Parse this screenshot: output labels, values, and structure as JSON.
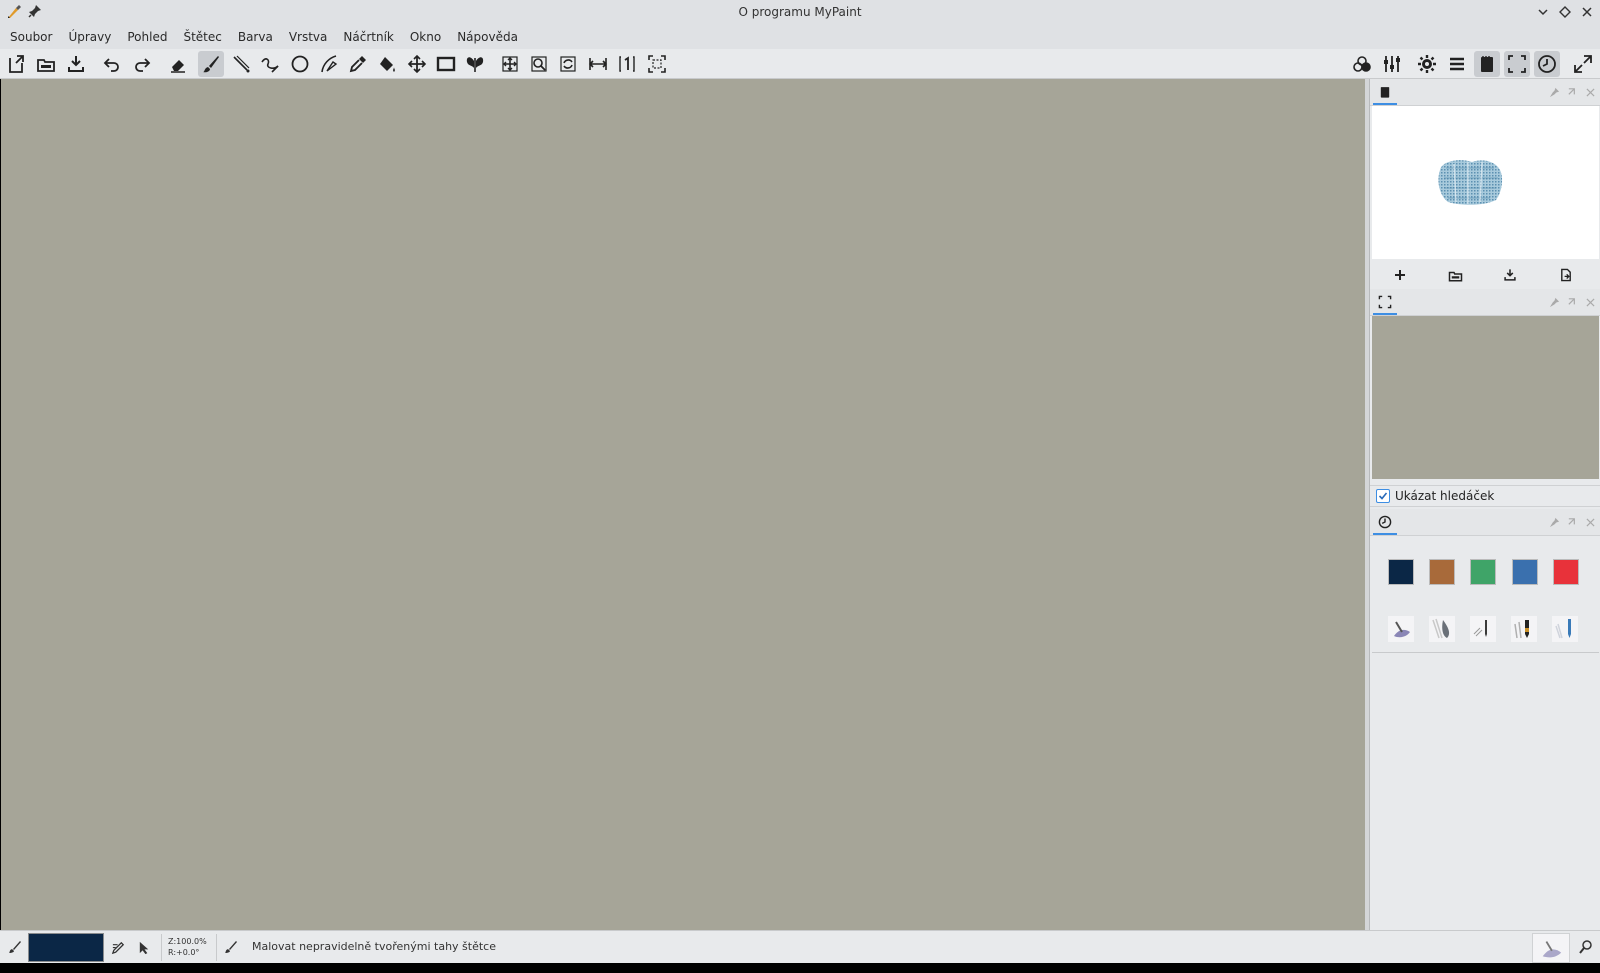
{
  "window": {
    "title": "O programu MyPaint"
  },
  "menu": [
    {
      "label": "Soubor"
    },
    {
      "label": "Úpravy"
    },
    {
      "label": "Pohled"
    },
    {
      "label": "Štětec"
    },
    {
      "label": "Barva"
    },
    {
      "label": "Vrstva"
    },
    {
      "label": "Náčrtník"
    },
    {
      "label": "Okno"
    },
    {
      "label": "Nápověda"
    }
  ],
  "toolbar_left": [
    "new-icon",
    "open-icon",
    "save-icon",
    "undo-icon",
    "redo-icon",
    "eraser-icon",
    "brush-icon",
    "inking-icon",
    "freehand-icon",
    "ellipse-icon",
    "pen-path-icon",
    "color-picker-icon",
    "fill-icon",
    "move-icon",
    "frame-icon",
    "symmetry-icon",
    "pan-icon",
    "zoom-icon",
    "rotate-icon",
    "mirror-icon",
    "reset-view-icon",
    "fit-view-icon"
  ],
  "toolbar_right": [
    "color-wheel-icon",
    "brush-settings-icon",
    "preferences-icon",
    "layers-icon",
    "scratchpad-icon",
    "preview-icon",
    "history-icon",
    "fullscreen-icon"
  ],
  "sidebar": {
    "preview": {
      "show_viewfinder_label": "Ukázat hledáček",
      "show_viewfinder_checked": true
    },
    "favorites": {
      "colors": [
        "#0b2746",
        "#a86a3a",
        "#3fa468",
        "#3a70ae",
        "#e8323a"
      ],
      "brushes": [
        "brush-fav-airbrush",
        "brush-fav-smudge",
        "brush-fav-pencil",
        "brush-fav-charcoal",
        "brush-fav-pen"
      ]
    }
  },
  "status": {
    "current_color": "#0b2746",
    "zoom_label": "Z:100.0%",
    "rotation_label": "R:+0.0°",
    "message": "Malovat nepravidelně tvořenými tahy štětce"
  },
  "colors": {
    "canvas_bg": "#a6a598",
    "accent": "#3d8ee3"
  }
}
